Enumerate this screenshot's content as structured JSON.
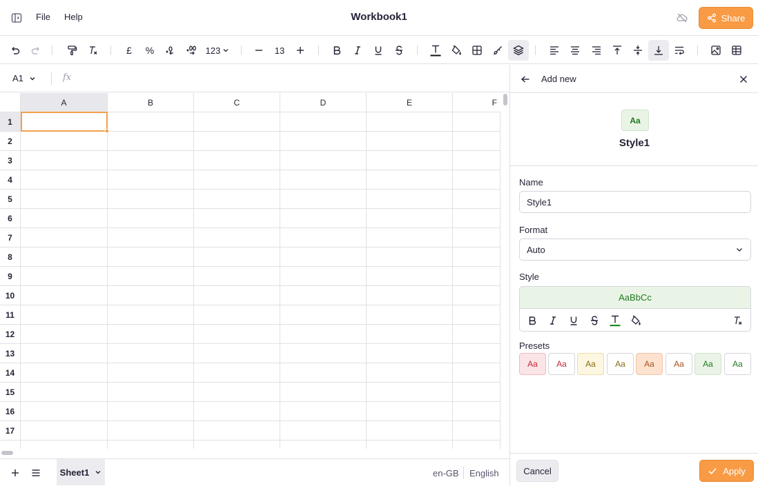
{
  "app": {
    "title": "Workbook1",
    "menu": [
      "File",
      "Help"
    ],
    "share_label": "Share",
    "accent_color": "#f89b44"
  },
  "toolbar": {
    "font_size": "13",
    "number_format_label": "123",
    "currency_symbol": "£",
    "percent_symbol": "%"
  },
  "formula_bar": {
    "cell_reference": "A1",
    "fx_label": "fx",
    "formula_value": ""
  },
  "grid": {
    "columns": [
      "A",
      "B",
      "C",
      "D",
      "E",
      "F"
    ],
    "rows": [
      "1",
      "2",
      "3",
      "4",
      "5",
      "6",
      "7",
      "8",
      "9",
      "10",
      "11",
      "12",
      "13",
      "14",
      "15",
      "16",
      "17"
    ],
    "selected_cell": "A1"
  },
  "bottom_bar": {
    "sheet_name": "Sheet1",
    "locale": "en-GB",
    "language": "English"
  },
  "panel": {
    "title": "Add new",
    "preview_text": "Aa",
    "preview_name": "Style1",
    "name_label": "Name",
    "name_value": "Style1",
    "format_label": "Format",
    "format_value": "Auto",
    "style_label": "Style",
    "style_sample": "AaBbCc",
    "presets_label": "Presets",
    "presets": [
      {
        "text": "Aa",
        "bg": "#fbe4e6",
        "fg": "#c62834",
        "border": "#f2b8bf"
      },
      {
        "text": "Aa",
        "bg": "#ffffff",
        "fg": "#c62834",
        "border": "#d4d4dc"
      },
      {
        "text": "Aa",
        "bg": "#fdf6e0",
        "fg": "#8a6a10",
        "border": "#ecdca6"
      },
      {
        "text": "Aa",
        "bg": "#ffffff",
        "fg": "#8a6a10",
        "border": "#d4d4dc"
      },
      {
        "text": "Aa",
        "bg": "#fde2d0",
        "fg": "#a6501a",
        "border": "#f1c4a6"
      },
      {
        "text": "Aa",
        "bg": "#ffffff",
        "fg": "#a6501a",
        "border": "#d4d4dc"
      },
      {
        "text": "Aa",
        "bg": "#eaf4e6",
        "fg": "#1f7a1f",
        "border": "#cfe3c8"
      },
      {
        "text": "Aa",
        "bg": "#ffffff",
        "fg": "#1f7a1f",
        "border": "#d4d4dc"
      }
    ],
    "style_accent_color": "#1f7a1f",
    "cancel_label": "Cancel",
    "apply_label": "Apply"
  }
}
